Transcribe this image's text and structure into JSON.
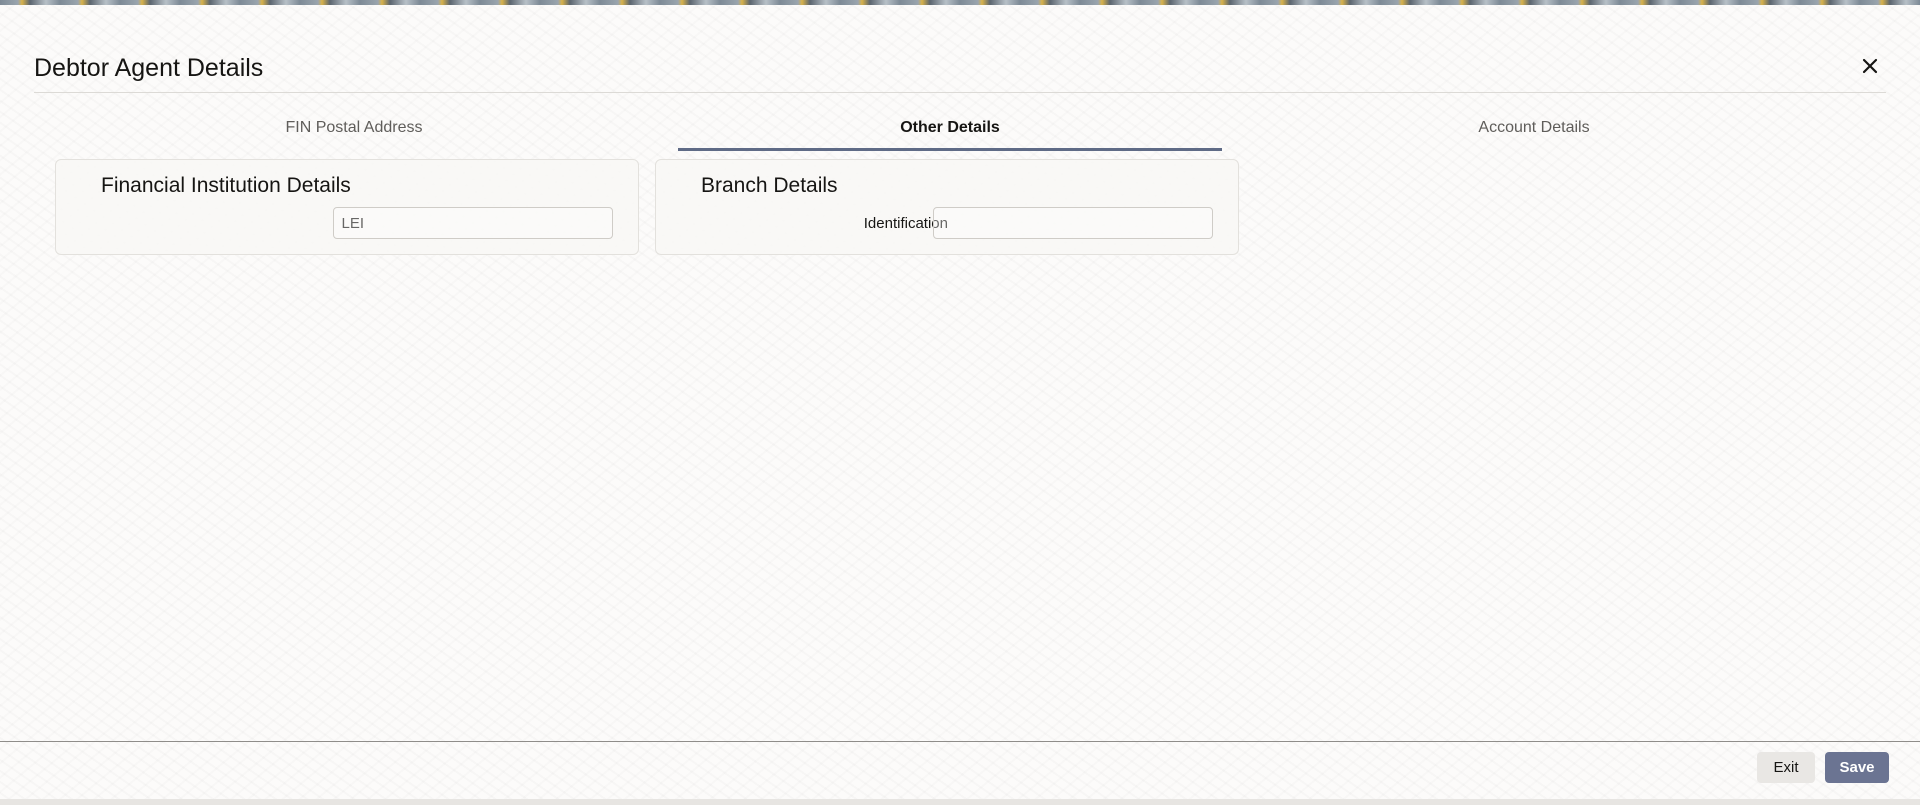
{
  "dialog": {
    "title": "Debtor Agent Details",
    "close_icon": "close-icon"
  },
  "tabs": [
    {
      "label": "FIN Postal Address",
      "active": false
    },
    {
      "label": "Other Details",
      "active": true
    },
    {
      "label": "Account Details",
      "active": false
    }
  ],
  "panels": {
    "financial_institution": {
      "title": "Financial Institution Details",
      "lei_label": "LEI",
      "lei_value": ""
    },
    "branch": {
      "title": "Branch Details",
      "identification_label": "Identification",
      "identification_value": ""
    }
  },
  "footer": {
    "exit_label": "Exit",
    "save_label": "Save"
  },
  "colors": {
    "accent": "#5f6b86",
    "save_button": "#6b7492"
  }
}
